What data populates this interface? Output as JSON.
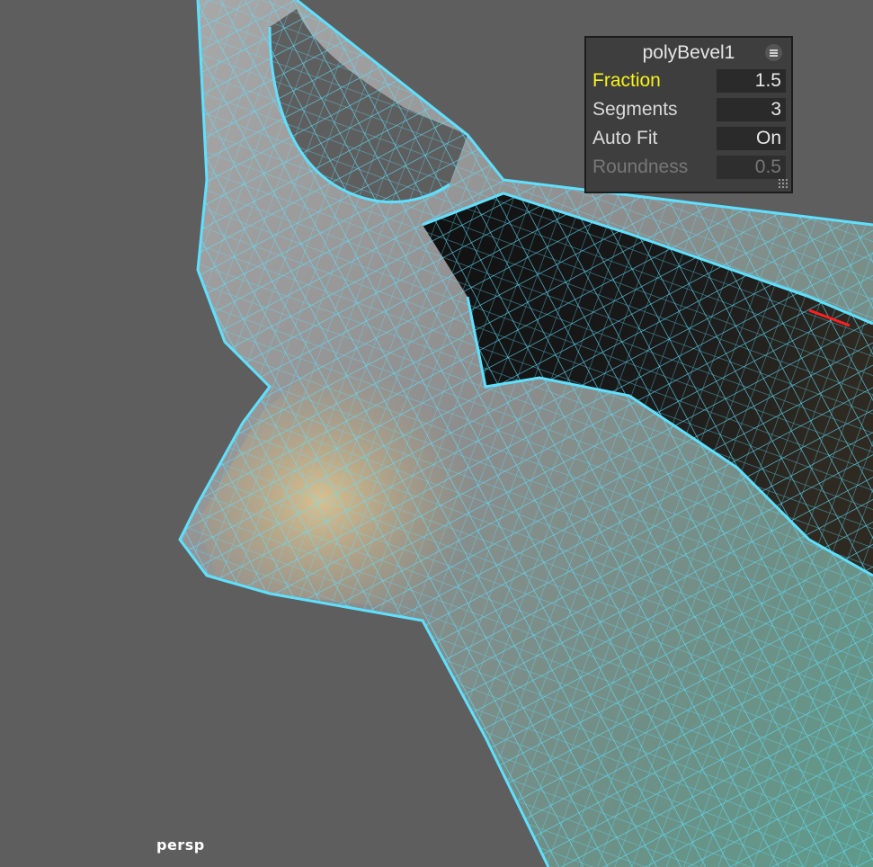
{
  "viewport": {
    "camera": "persp",
    "background_color": "#5e5e5e",
    "wire_color": "#5fe0ff"
  },
  "hud": {
    "title": "polyBevel1",
    "menu_icon": "hamburger-menu-icon",
    "rows": [
      {
        "label": "Fraction",
        "value": "1.5",
        "state": "active"
      },
      {
        "label": "Segments",
        "value": "3",
        "state": "normal"
      },
      {
        "label": "Auto Fit",
        "value": "On",
        "state": "normal"
      },
      {
        "label": "Roundness",
        "value": "0.5",
        "state": "disabled"
      }
    ],
    "highlight_color": "#f7f21a"
  }
}
